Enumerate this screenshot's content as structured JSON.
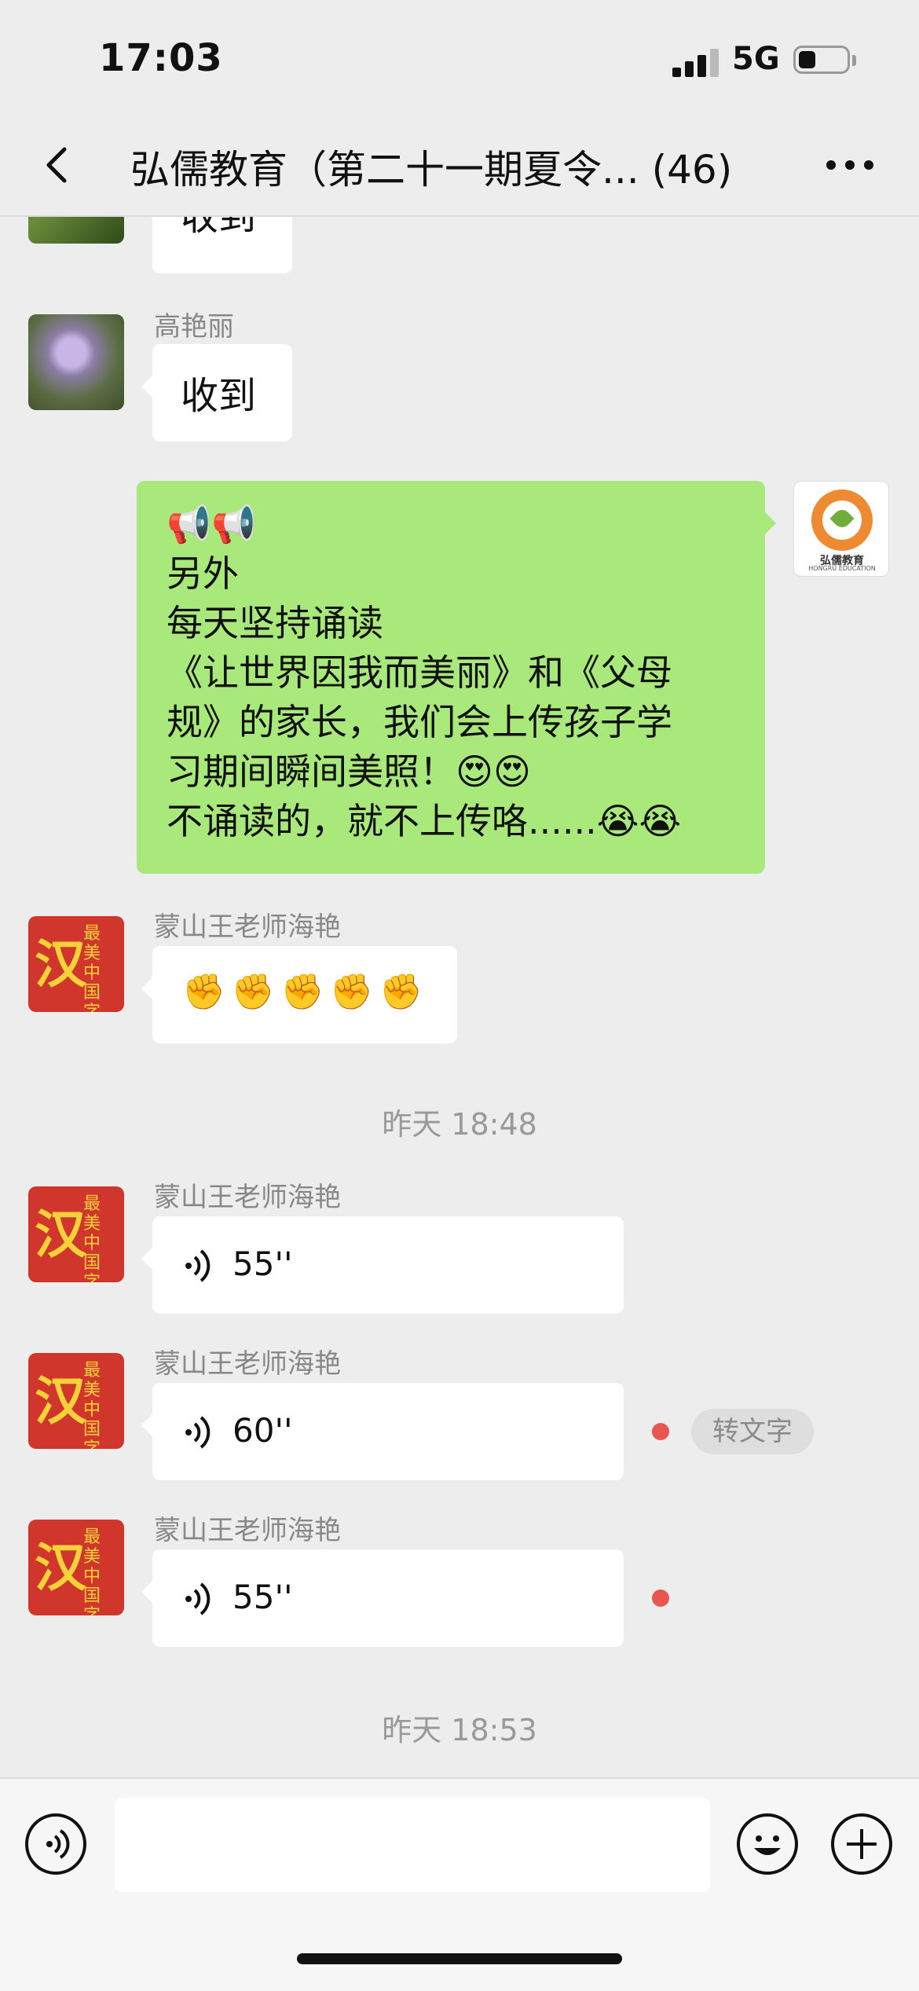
{
  "status": {
    "time": "17:03",
    "network": "5G",
    "battery_level": 0.35
  },
  "nav": {
    "back_icon": "chevron-left-icon",
    "title": "弘儒教育（第二十一期夏令... (46)",
    "more_icon": "ellipsis-icon"
  },
  "messages": [
    {
      "type": "text",
      "side": "left",
      "sender": "",
      "text": "收到"
    },
    {
      "type": "text",
      "side": "left",
      "sender": "高艳丽",
      "text": "收到"
    },
    {
      "type": "text",
      "side": "right",
      "lines": [
        "📢📢",
        "另外",
        "每天坚持诵读",
        "《让世界因我而美丽》和《父母",
        "规》的家长，我们会上传孩子学",
        "习期间瞬间美照！😍😍",
        "不诵读的，就不上传咯......😭😭"
      ]
    },
    {
      "type": "text",
      "side": "left",
      "sender": "蒙山王老师海艳",
      "text": "✊✊✊✊✊"
    },
    {
      "type": "time",
      "text": "昨天 18:48"
    },
    {
      "type": "voice",
      "side": "left",
      "sender": "蒙山王老师海艳",
      "duration": "55''",
      "unread": false
    },
    {
      "type": "voice",
      "side": "left",
      "sender": "蒙山王老师海艳",
      "duration": "60''",
      "unread": true,
      "action": "转文字"
    },
    {
      "type": "voice",
      "side": "left",
      "sender": "蒙山王老师海艳",
      "duration": "55''",
      "unread": true
    },
    {
      "type": "time",
      "text": "昨天 18:53"
    }
  ],
  "avatars": {
    "red_big": "汉",
    "red_small": "最美中国字",
    "logo_name": "弘儒教育",
    "logo_sub": "HONGRU EDUCATION"
  },
  "input": {
    "voice_icon": "voice-mode-icon",
    "emoji_icon": "emoji-icon",
    "plus_icon": "plus-icon",
    "placeholder": ""
  },
  "colors": {
    "bubble_self": "#a9e87a",
    "background": "#ededed",
    "unread_dot": "#e8574f"
  }
}
